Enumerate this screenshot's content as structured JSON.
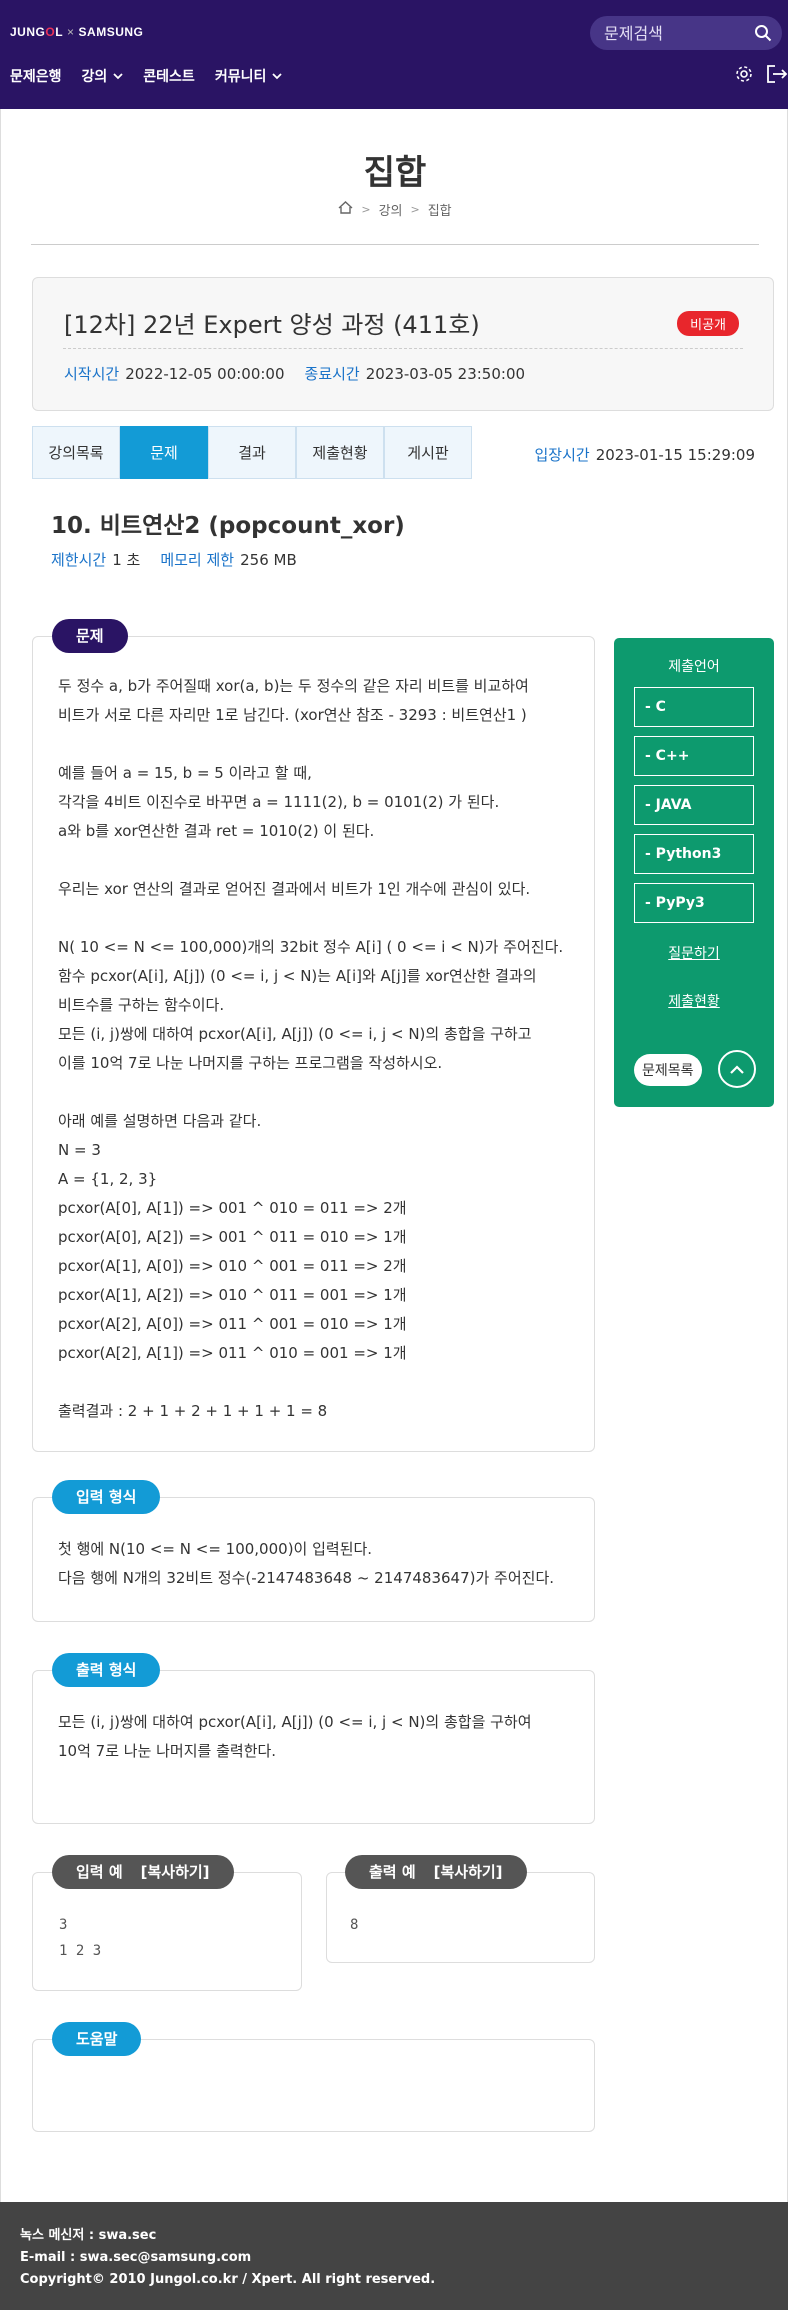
{
  "header": {
    "logo_left": "JUNG",
    "logo_o": "O",
    "logo_right": "L",
    "logo_sep": "×",
    "logo_brand": "SAMSUNG",
    "search_placeholder": "문제검색",
    "nav": [
      "문제은행",
      "강의",
      "콘테스트",
      "커뮤니티"
    ],
    "colors": {
      "header_bg": "#2a1464",
      "accent": "#139bd6",
      "sidebar": "#0d9a6e"
    }
  },
  "page": {
    "title": "집합",
    "breadcrumb": [
      "강의",
      "집합"
    ]
  },
  "course": {
    "title": "[12차] 22년 Expert 양성 과정 (411호)",
    "badge": "비공개",
    "start_label": "시작시간",
    "start_value": "2022-12-05 00:00:00",
    "end_label": "종료시간",
    "end_value": "2023-03-05 23:50:00"
  },
  "tabs": [
    "강의목록",
    "문제",
    "결과",
    "제출현황",
    "게시판"
  ],
  "active_tab": "문제",
  "entry": {
    "label": "입장시간",
    "value": "2023-01-15 15:29:09"
  },
  "problem": {
    "title": "10. 비트연산2 (popcount_xor)",
    "time_label": "제한시간",
    "time_value": "1 초",
    "mem_label": "메모리 제한",
    "mem_value": "256 MB",
    "section_label": "문제",
    "lines": [
      "두 정수 a, b가 주어질때 xor(a, b)는 두 정수의 같은 자리 비트를 비교하여",
      "비트가 서로 다른 자리만 1로 남긴다. (xor연산 참조 -  3293 : 비트연산1 )",
      "",
      "예를 들어 a = 15, b = 5 이라고 할 때,",
      "각각을 4비트 이진수로 바꾸면 a = 1111(2), b = 0101(2) 가 된다.",
      "a와 b를 xor연산한 결과 ret = 1010(2) 이 된다.",
      "",
      "우리는 xor 연산의 결과로 얻어진 결과에서 비트가 1인 개수에 관심이 있다.",
      "",
      "N( 10 <= N <= 100,000)개의 32bit 정수 A[i] ( 0 <= i < N)가 주어진다.",
      "함수 pcxor(A[i], A[j]) (0 <= i, j < N)는 A[i]와 A[j]를 xor연산한 결과의",
      "비트수를 구하는 함수이다.",
      "모든 (i, j)쌍에 대하여 pcxor(A[i], A[j]) (0 <= i, j < N)의 총합을 구하고",
      "이를 10억 7로 나눈 나머지를 구하는 프로그램을 작성하시오.",
      "",
      "아래 예를 설명하면 다음과 같다.",
      "N = 3",
      "A = {1, 2, 3}",
      "pcxor(A[0], A[1]) => 001 ^ 010 = 011 => 2개",
      "pcxor(A[0], A[2]) => 001 ^ 011 = 010 => 1개",
      "pcxor(A[1], A[0]) => 010 ^ 001 = 011 => 2개",
      "pcxor(A[1], A[2]) => 010 ^ 011 = 001 => 1개",
      "pcxor(A[2], A[0]) => 011 ^ 001 = 010 => 1개",
      "pcxor(A[2], A[1]) => 011 ^ 010 = 001 => 1개",
      "",
      "출력결과 : 2 + 1 + 2 + 1 + 1 + 1 = 8"
    ]
  },
  "input_format": {
    "label": "입력 형식",
    "lines": [
      "첫 행에 N(10 <= N <= 100,000)이 입력된다.",
      "다음 행에 N개의 32비트 정수(-2147483648 ~ 2147483647)가 주어진다."
    ]
  },
  "output_format": {
    "label": "출력 형식",
    "lines": [
      "모든 (i, j)쌍에 대하여 pcxor(A[i], A[j]) (0 <= i, j < N)의 총합을 구하여",
      "10억 7로 나눈 나머지를 출력한다."
    ]
  },
  "sample_input": {
    "label": "입력 예",
    "copy": "[복사하기]",
    "lines": [
      "3",
      "1 2 3"
    ]
  },
  "sample_output": {
    "label": "출력 예",
    "copy": "[복사하기]",
    "lines": [
      "8"
    ]
  },
  "help": {
    "label": "도움말"
  },
  "sidebar": {
    "title": "제출언어",
    "languages": [
      "- C",
      "- C++",
      "- JAVA",
      "- Python3",
      "- PyPy3"
    ],
    "ask": "질문하기",
    "status": "제출현황",
    "list": "문제목록"
  },
  "footer": {
    "lines": [
      "녹스 메신저 : swa.sec",
      "E-mail : swa.sec@samsung.com",
      "Copyright© 2010 Jungol.co.kr / Xpert. All right reserved."
    ]
  }
}
